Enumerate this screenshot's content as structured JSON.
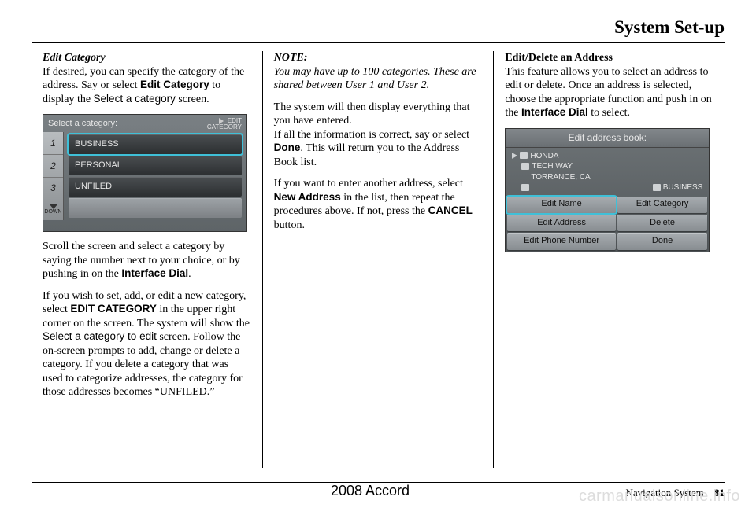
{
  "page": {
    "title": "System Set-up",
    "footer_center": "2008  Accord",
    "footer_section": "Navigation System",
    "page_number": "81",
    "watermark": "carmanualsonline.info"
  },
  "col1": {
    "heading": "Edit Category",
    "p1_a": "If desired, you can specify the category of the address. Say or select ",
    "p1_b": "Edit Category",
    "p1_c": " to display the ",
    "p1_d": "Select a category",
    "p1_e": " screen.",
    "shot": {
      "title": "Select a category:",
      "edit_line1": "EDIT",
      "edit_line2": "CATEGORY",
      "nums": [
        "1",
        "2",
        "3"
      ],
      "down": "DOWN",
      "rows": [
        "BUSINESS",
        "PERSONAL",
        "UNFILED"
      ]
    },
    "p2_a": "Scroll the screen and select a category by saying the number next to your choice, or by pushing in on the ",
    "p2_b": "Interface Dial",
    "p2_c": ".",
    "p3_a": "If you wish to set, add, or edit a new category, select ",
    "p3_b": "EDIT CATEGORY",
    "p3_c": " in the upper right corner on the screen. The system will show the ",
    "p3_d": "Select a category to edit",
    "p3_e": " screen. Follow the on-screen prompts to add, change or delete a category. If you delete a category that was used to categorize addresses, the category for those addresses becomes “UNFILED.”"
  },
  "col2": {
    "note_label": "NOTE:",
    "note_body": "You may have up to 100 categories. These are shared between User 1 and User 2.",
    "p1": "The system will then display everything that you have entered.",
    "p2_a": "If all the information is correct, say or select ",
    "p2_b": "Done",
    "p2_c": ". This will return you to the Address Book list.",
    "p3_a": "If you want to enter another address, select ",
    "p3_b": "New Address",
    "p3_c": " in the list, then repeat the procedures above. If not, press the ",
    "p3_d": "CANCEL",
    "p3_e": " button."
  },
  "col3": {
    "heading": "Edit/Delete an Address",
    "p1_a": "This feature allows you to select an address to edit or delete. Once an address is selected, choose the appropriate function and push in on the ",
    "p1_b": "Interface Dial",
    "p1_c": " to select.",
    "shot": {
      "title": "Edit address book:",
      "line1": "HONDA",
      "line2": "TECH WAY",
      "line3": "TORRANCE, CA",
      "biz": "BUSINESS",
      "buttons": [
        "Edit Name",
        "Edit Category",
        "Edit Address",
        "Delete",
        "Edit Phone Number",
        "Done"
      ]
    }
  }
}
